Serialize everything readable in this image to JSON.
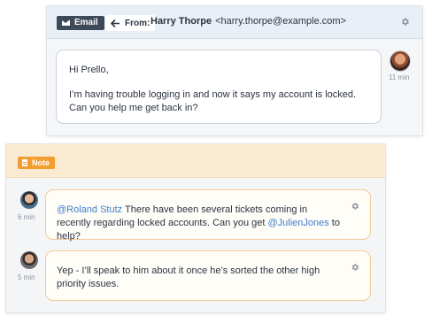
{
  "email": {
    "badge_label": "Email",
    "from_label": "From:",
    "sender_name": "Harry Thorpe",
    "sender_email": "<harry.thorpe@example.com>",
    "greeting": "Hi Prello,",
    "body": "I’m having trouble logging in and now it says my account is locked. Can you help me get back in?",
    "time": "11 min"
  },
  "note": {
    "badge_label": "Note",
    "comments": [
      {
        "time": "6 min",
        "mention1": "@Roland Stutz",
        "text1": " There have been several tickets coming in recently regarding locked accounts. Can you get ",
        "mention2": "@JulienJones",
        "text2": " to help?"
      },
      {
        "time": "5 min",
        "text": "Yep - I’ll speak to him about it once he’s sorted the other high priority issues."
      }
    ]
  },
  "colors": {
    "email_badge": "#3c4a5a",
    "note_badge": "#f29d2e",
    "note_header": "#fbead2",
    "mention": "#3d7fc9"
  },
  "icons": [
    "envelope-icon",
    "reply-arrow-icon",
    "gear-icon",
    "document-icon"
  ]
}
